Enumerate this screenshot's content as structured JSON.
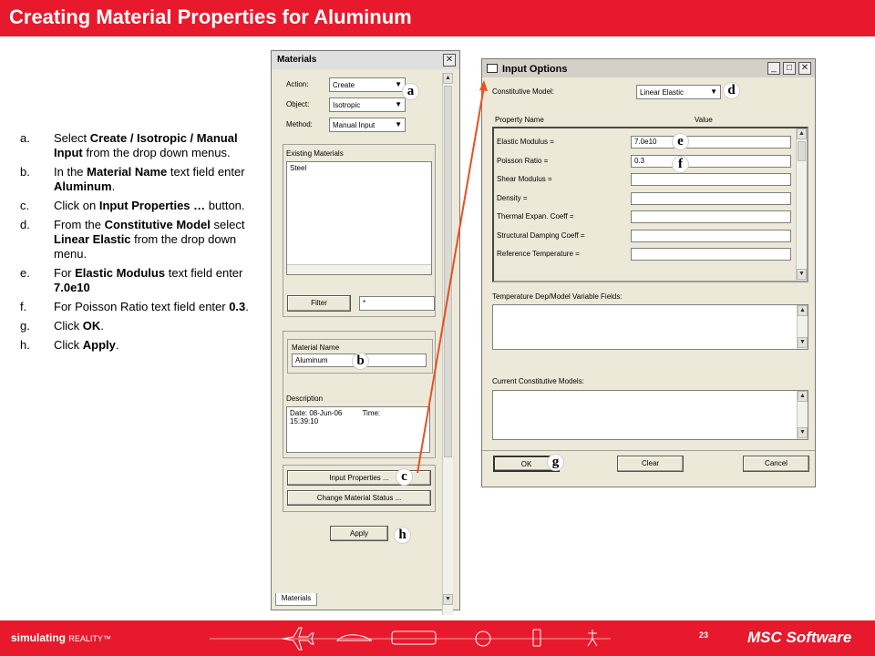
{
  "slide": {
    "title": "Creating Material Properties for Aluminum",
    "page_number": "23"
  },
  "steps": [
    {
      "letter": "a.",
      "parts": [
        "Select ",
        "Create / Isotropic / Manual Input",
        " from the drop down menus."
      ]
    },
    {
      "letter": "b.",
      "parts": [
        "In the ",
        "Material Name",
        " text field enter ",
        "Aluminum",
        "."
      ]
    },
    {
      "letter": "c.",
      "parts": [
        "Click on ",
        "Input Properties …",
        " button."
      ]
    },
    {
      "letter": "d.",
      "parts": [
        "From the ",
        "Constitutive Model",
        " select ",
        "Linear Elastic",
        " from the drop down menu."
      ]
    },
    {
      "letter": "e.",
      "parts": [
        "For ",
        "Elastic Modulus",
        " text field enter ",
        "7.0e10"
      ]
    },
    {
      "letter": "f.",
      "parts": [
        "For Poisson Ratio text field enter ",
        "0.3",
        "."
      ]
    },
    {
      "letter": "g.",
      "parts": [
        "Click ",
        "OK",
        "."
      ]
    },
    {
      "letter": "h.",
      "parts": [
        "Click ",
        "Apply",
        "."
      ]
    }
  ],
  "materials_window": {
    "title": "Materials",
    "action_label": "Action:",
    "action_value": "Create",
    "object_label": "Object:",
    "object_value": "Isotropic",
    "method_label": "Method:",
    "method_value": "Manual Input",
    "existing_label": "Existing Materials",
    "existing_items": [
      "Steel"
    ],
    "filter_button": "Filter",
    "filter_value": "*",
    "material_name_label": "Material Name",
    "material_name_value": "Aluminum",
    "description_label": "Description",
    "description_line1": "Date: 08-Jun-06          Time:",
    "description_line2": "15:39:10",
    "input_properties_button": "Input Properties ...",
    "change_status_button": "Change Material Status ...",
    "apply_button": "Apply",
    "tab_label": "Materials"
  },
  "input_window": {
    "title": "Input Options",
    "constitutive_label": "Constitutive Model:",
    "constitutive_value": "Linear Elastic",
    "col_property": "Property Name",
    "col_value": "Value",
    "properties": [
      {
        "name": "Elastic Modulus =",
        "value": "7.0e10"
      },
      {
        "name": "Poisson Ratio =",
        "value": "0.3"
      },
      {
        "name": "Shear Modulus =",
        "value": ""
      },
      {
        "name": "Density =",
        "value": ""
      },
      {
        "name": "Thermal Expan. Coeff =",
        "value": ""
      },
      {
        "name": "Structural Damping Coeff =",
        "value": ""
      },
      {
        "name": "Reference Temperature =",
        "value": ""
      }
    ],
    "temp_dep_label": "Temperature Dep/Model Variable Fields:",
    "current_models_label": "Current Constitutive Models:",
    "ok_button": "OK",
    "clear_button": "Clear",
    "cancel_button": "Cancel"
  },
  "callouts": [
    "a",
    "b",
    "c",
    "d",
    "e",
    "f",
    "g",
    "h"
  ],
  "footer": {
    "tagline_bold": "simulating",
    "tagline_rest": "REALITY™",
    "logo": "MSC Software"
  },
  "colors": {
    "brand_red": "#e8192c",
    "window_bg": "#ece9d8",
    "arrow": "#e8501e"
  }
}
